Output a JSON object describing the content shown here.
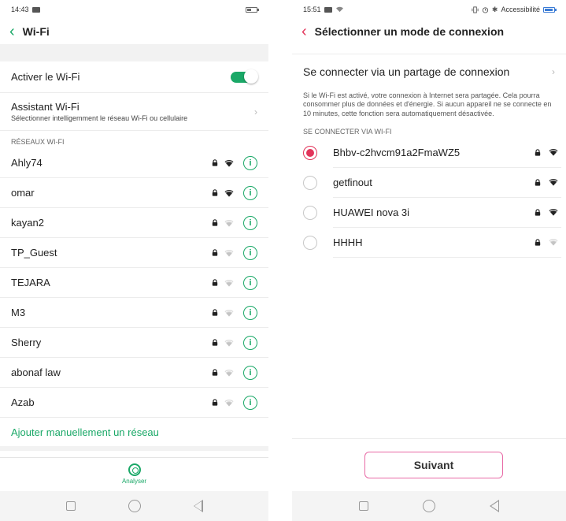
{
  "left": {
    "status": {
      "time": "14:43"
    },
    "header": {
      "title": "Wi-Fi"
    },
    "wifi_toggle": {
      "label": "Activer le Wi-Fi",
      "enabled": true
    },
    "assistant": {
      "title": "Assistant Wi-Fi",
      "subtitle": "Sélectionner intelligemment le réseau Wi-Fi ou cellulaire"
    },
    "section_title": "RÉSEAUX WI-FI",
    "networks": [
      {
        "name": "Ahly74",
        "signal": "strong"
      },
      {
        "name": "omar",
        "signal": "strong"
      },
      {
        "name": "kayan2",
        "signal": "weak"
      },
      {
        "name": "TP_Guest",
        "signal": "weak"
      },
      {
        "name": "TEJARA",
        "signal": "weak"
      },
      {
        "name": "M3",
        "signal": "weak"
      },
      {
        "name": "Sherry",
        "signal": "weak"
      },
      {
        "name": "abonaf law",
        "signal": "weak"
      },
      {
        "name": "Azab",
        "signal": "weak"
      }
    ],
    "add_network": "Ajouter manuellement un réseau",
    "analyse": {
      "label": "Analyser"
    },
    "accent_color": "#1aa867"
  },
  "right": {
    "status": {
      "time": "15:51",
      "accessibility": "Accessibilité"
    },
    "header": {
      "title": "Sélectionner un mode de connexion"
    },
    "hotspot": {
      "label": "Se connecter via un partage de connexion"
    },
    "description": "Si le Wi-Fi est activé, votre connexion à Internet sera partagée. Cela pourra consommer plus de données et d'énergie. Si aucun appareil ne se connecte en 10 minutes, cette fonction sera automatiquement désactivée.",
    "section_title": "SE CONNECTER VIA WI-FI",
    "networks": [
      {
        "name": "Bhbv-c2hvcm91a2FmaWZ5",
        "selected": true,
        "signal": "strong"
      },
      {
        "name": "getfinout",
        "selected": false,
        "signal": "strong"
      },
      {
        "name": "HUAWEI nova 3i",
        "selected": false,
        "signal": "strong"
      },
      {
        "name": "HHHH",
        "selected": false,
        "signal": "weak"
      }
    ],
    "next_button": "Suivant",
    "accent_color": "#e2345a"
  }
}
